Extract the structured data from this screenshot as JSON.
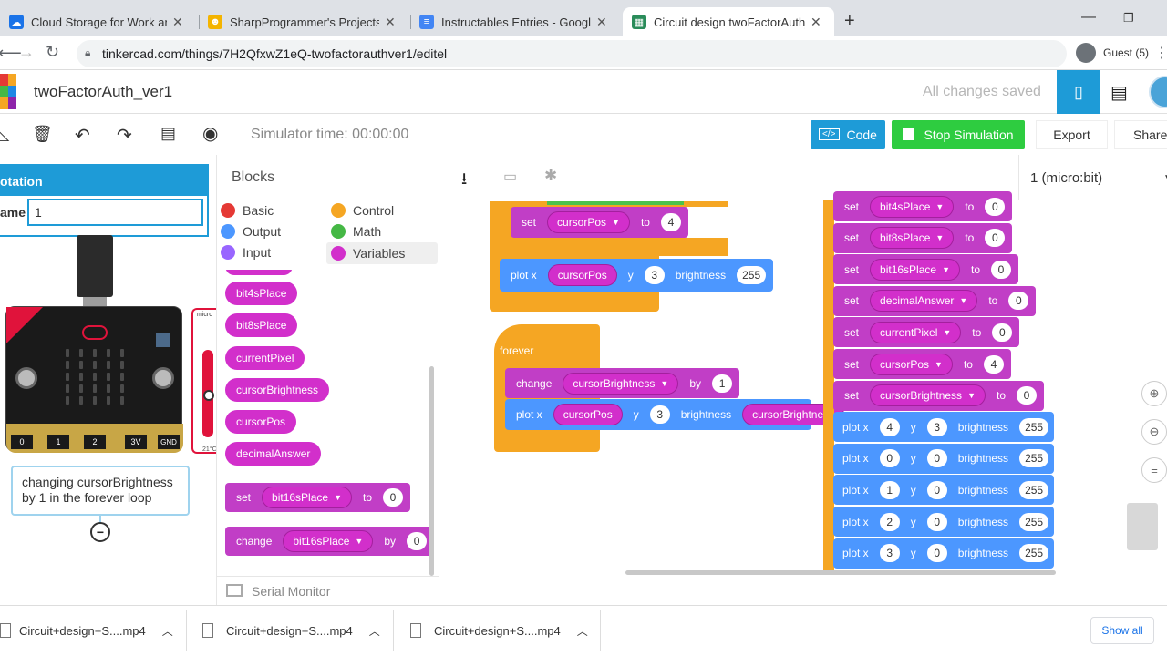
{
  "browser": {
    "tabs": [
      {
        "title": "Cloud Storage for Work and Hom",
        "icon": "cloud-icon"
      },
      {
        "title": "SharpProgrammer's Projects - Ins",
        "icon": "robot-icon"
      },
      {
        "title": "Instructables Entries - Google Do",
        "icon": "docs-icon"
      },
      {
        "title": "Circuit design twoFactorAuth_ver",
        "icon": "tinkercad-icon"
      }
    ],
    "new_tab": "+",
    "url": "tinkercad.com/things/7H2QfxwZ1eQ-twofactorauthver1/editel",
    "profile": "Guest (5)"
  },
  "app": {
    "project_name": "twoFactorAuth_ver1",
    "save_status": "All changes saved",
    "simulator_time": "Simulator time: 00:00:00",
    "code_btn": "Code",
    "stop_btn": "Stop Simulation",
    "export_btn": "Export",
    "share_btn": "Share"
  },
  "annotation": {
    "header": "otation",
    "name_label": "ame",
    "name_value": "1",
    "note": "changing cursorBrightness by 1 in the forever loop",
    "micro_label": "micro",
    "temp_label": "21°C"
  },
  "blocks_panel": {
    "title": "Blocks",
    "categories": [
      {
        "label": "Basic",
        "color": "#e53935"
      },
      {
        "label": "Control",
        "color": "#f5a623"
      },
      {
        "label": "Output",
        "color": "#4c97ff"
      },
      {
        "label": "Math",
        "color": "#45b845"
      },
      {
        "label": "Input",
        "color": "#9966ff"
      },
      {
        "label": "Variables",
        "color": "#d22fcb"
      }
    ],
    "variables": [
      "bit4sPlace",
      "bit8sPlace",
      "currentPixel",
      "cursorBrightness",
      "cursorPos",
      "decimalAnswer"
    ],
    "set_block": {
      "kw": "set",
      "var": "bit16sPlace",
      "to": "to",
      "val": "0"
    },
    "change_block": {
      "kw": "change",
      "var": "bit16sPlace",
      "by": "by",
      "val": "0"
    },
    "serial_monitor": "Serial Monitor"
  },
  "canvas": {
    "device_select": "1 (micro:bit)",
    "kw": {
      "set": "set",
      "to": "to",
      "by": "by",
      "change": "change",
      "plot": "plot x",
      "y": "y",
      "brightness": "brightness",
      "forever": "forever"
    },
    "block1": {
      "var": "cursorPos",
      "val": "4"
    },
    "block2": {
      "var": "cursorPos",
      "y": "3",
      "b": "255"
    },
    "forever": {
      "change_var": "cursorBrightness",
      "change_val": "1",
      "plot_var": "cursorPos",
      "plot_y": "3",
      "plot_b": "cursorBrightness"
    },
    "right_sets": [
      {
        "var": "bit4sPlace",
        "val": "0"
      },
      {
        "var": "bit8sPlace",
        "val": "0"
      },
      {
        "var": "bit16sPlace",
        "val": "0"
      },
      {
        "var": "decimalAnswer",
        "val": "0"
      },
      {
        "var": "currentPixel",
        "val": "0"
      },
      {
        "var": "cursorPos",
        "val": "4"
      },
      {
        "var": "cursorBrightness",
        "val": "0"
      }
    ],
    "right_plots": [
      {
        "x": "4",
        "y": "3",
        "b": "255"
      },
      {
        "x": "0",
        "y": "0",
        "b": "255"
      },
      {
        "x": "1",
        "y": "0",
        "b": "255"
      },
      {
        "x": "2",
        "y": "0",
        "b": "255"
      },
      {
        "x": "3",
        "y": "0",
        "b": "255"
      }
    ]
  },
  "microbit": {
    "pins": [
      "0",
      "1",
      "2",
      "3V",
      "GND"
    ]
  },
  "downloads": {
    "items": [
      "Circuit+design+S....mp4",
      "Circuit+design+S....mp4",
      "Circuit+design+S....mp4"
    ],
    "show_all": "Show all"
  }
}
